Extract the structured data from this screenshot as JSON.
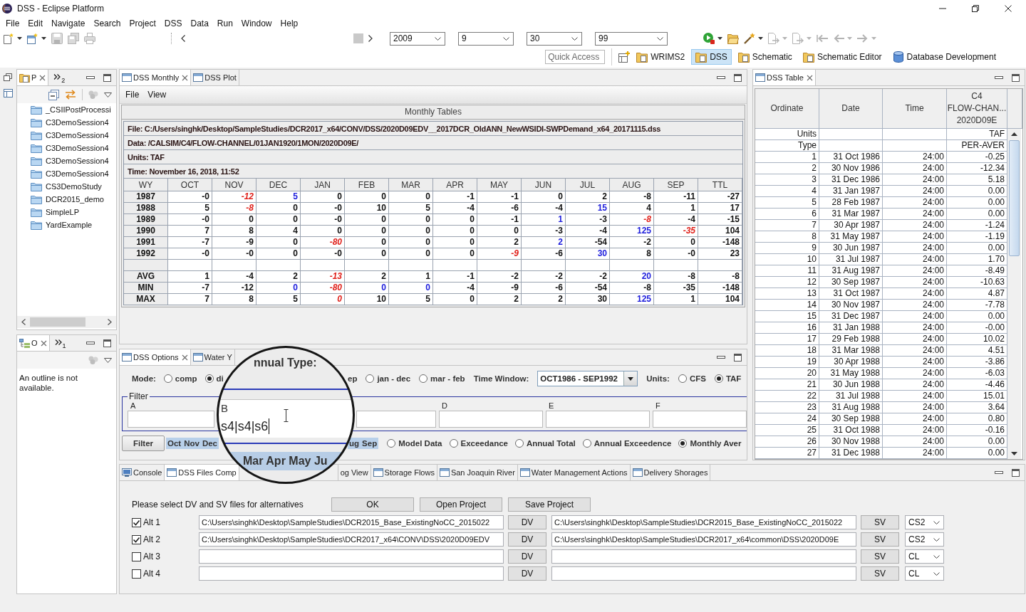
{
  "window": {
    "title": "DSS - Eclipse Platform"
  },
  "menu_bar": [
    "File",
    "Edit",
    "Navigate",
    "Search",
    "Project",
    "DSS",
    "Data",
    "Run",
    "Window",
    "Help"
  ],
  "toolbar": {
    "left": [
      {
        "kind": "new",
        "dropdown": true,
        "disabled": false
      },
      {
        "kind": "new-window",
        "dropdown": true,
        "disabled": false
      },
      {
        "kind": "save",
        "disabled": true
      },
      {
        "kind": "save-all",
        "disabled": true
      },
      {
        "kind": "print",
        "disabled": true
      }
    ],
    "selectors": [
      "2009",
      "9",
      "30",
      "99"
    ],
    "right": [
      {
        "kind": "run",
        "dropdown": true,
        "disabled": false
      },
      {
        "kind": "folder",
        "disabled": false
      },
      {
        "kind": "wand",
        "dropdown": true,
        "disabled": false
      },
      {
        "kind": "document-arrow",
        "dropdown": true,
        "disabled": true
      },
      {
        "kind": "document-arrow",
        "dropdown": true,
        "disabled": true
      },
      {
        "kind": "back",
        "disabled": true
      },
      {
        "kind": "arrow-left",
        "dropdown": true,
        "disabled": true
      },
      {
        "kind": "arrow-right",
        "dropdown": true,
        "disabled": true
      }
    ]
  },
  "quick_access": {
    "placeholder": "Quick Access"
  },
  "perspectives": [
    {
      "label": "WRIMS2",
      "kind": "folder",
      "selected": false
    },
    {
      "label": "DSS",
      "kind": "folder",
      "selected": true
    },
    {
      "label": "Schematic",
      "kind": "folder",
      "selected": false
    },
    {
      "label": "Schematic Editor",
      "kind": "folder",
      "selected": false
    },
    {
      "label": "Database Development",
      "kind": "database",
      "selected": false
    }
  ],
  "explorer": {
    "tab": {
      "label": "P",
      "selected": true
    },
    "overflow": "2",
    "items": [
      {
        "label": "_CSIIPostProcessi",
        "selected": false
      },
      {
        "label": "C3DemoSession4",
        "selected": false
      },
      {
        "label": "C3DemoSession4",
        "selected": false
      },
      {
        "label": "C3DemoSession4",
        "selected": false
      },
      {
        "label": "C3DemoSession4",
        "selected": false
      },
      {
        "label": "C3DemoSession4",
        "selected": false
      },
      {
        "label": "CS3DemoStudy",
        "selected": false
      },
      {
        "label": "DCR2015_demo",
        "selected": false
      },
      {
        "label": "SimpleLP",
        "selected": false
      },
      {
        "label": "YardExample",
        "selected": false
      }
    ]
  },
  "outline": {
    "tab": {
      "label": "O",
      "selected": true
    },
    "overflow": "1",
    "message": "An outline is not available."
  },
  "monthly": {
    "tabs": [
      {
        "label": "DSS Monthly",
        "selected": true
      },
      {
        "label": "DSS Plot",
        "selected": false
      }
    ],
    "menu": [
      "File",
      "View"
    ],
    "title": "Monthly Tables",
    "info": [
      "File: C:/Users/singhk/Desktop/SampleStudies/DCR2017_x64/CONV/DSS/2020D09EDV__2017DCR_OldANN_NewWSIDI-SWPDemand_x64_20171115.dss",
      "Data: /CALSIM/C4/FLOW-CHANNEL/01JAN1920/1MON/2020D09E/",
      "Units: TAF",
      "Time: November 16, 2018, 11:52"
    ],
    "columns": [
      "WY",
      "OCT",
      "NOV",
      "DEC",
      "JAN",
      "FEB",
      "MAR",
      "APR",
      "MAY",
      "JUN",
      "JUL",
      "AUG",
      "SEP",
      "TTL"
    ],
    "rows": [
      {
        "kind": "data",
        "label": "1987",
        "cells": [
          "-0",
          {
            "text": "-12",
            "color": "#e0211b",
            "italic": true
          },
          {
            "text": "5",
            "color": "#1c1cdc"
          },
          "0",
          "0",
          "0",
          "-1",
          "-1",
          "0",
          "2",
          "-8",
          "-11",
          "-27"
        ]
      },
      {
        "kind": "data",
        "label": "1988",
        "cells": [
          "5",
          {
            "text": "-8",
            "color": "#e0211b",
            "italic": true
          },
          "0",
          "-0",
          "10",
          "5",
          "-4",
          "-6",
          "-4",
          {
            "text": "15",
            "color": "#1c1cdc"
          },
          "4",
          "1",
          "17"
        ]
      },
      {
        "kind": "data",
        "label": "1989",
        "cells": [
          "-0",
          "0",
          "0",
          "-0",
          "0",
          "0",
          "0",
          "-1",
          {
            "text": "1",
            "color": "#1c1cdc"
          },
          "-3",
          {
            "text": "-8",
            "color": "#e0211b",
            "italic": true
          },
          "-4",
          "-15"
        ]
      },
      {
        "kind": "data",
        "label": "1990",
        "cells": [
          "7",
          "8",
          "4",
          "0",
          "0",
          "0",
          "0",
          "0",
          "-3",
          "-4",
          {
            "text": "125",
            "color": "#1c1cdc"
          },
          {
            "text": "-35",
            "color": "#e0211b",
            "italic": true
          },
          "104"
        ]
      },
      {
        "kind": "data",
        "label": "1991",
        "cells": [
          "-7",
          "-9",
          "0",
          {
            "text": "-80",
            "color": "#e0211b",
            "italic": true
          },
          "0",
          "0",
          "0",
          "2",
          {
            "text": "2",
            "color": "#1c1cdc"
          },
          "-54",
          "-2",
          "0",
          "-148"
        ]
      },
      {
        "kind": "data",
        "label": "1992",
        "cells": [
          "-0",
          "-0",
          "0",
          "-0",
          "0",
          "0",
          "0",
          {
            "text": "-9",
            "color": "#e0211b",
            "italic": true
          },
          "-6",
          {
            "text": "30",
            "color": "#1c1cdc"
          },
          "8",
          "-0",
          "23"
        ]
      },
      {
        "kind": "spacer"
      },
      {
        "kind": "data",
        "label": "AVG",
        "cells": [
          "1",
          "-4",
          "2",
          {
            "text": "-13",
            "color": "#e0211b",
            "italic": true
          },
          "2",
          "1",
          "-1",
          "-2",
          "-2",
          "-2",
          {
            "text": "20",
            "color": "#1c1cdc"
          },
          "-8",
          "-8"
        ]
      },
      {
        "kind": "data",
        "label": "MIN",
        "cells": [
          "-7",
          "-12",
          {
            "text": "0",
            "color": "#1c1cdc"
          },
          {
            "text": "-80",
            "color": "#e0211b",
            "italic": true
          },
          {
            "text": "0",
            "color": "#1c1cdc"
          },
          {
            "text": "0",
            "color": "#1c1cdc"
          },
          "-4",
          "-9",
          "-6",
          "-54",
          "-8",
          "-35",
          "-148"
        ]
      },
      {
        "kind": "data",
        "label": "MAX",
        "cells": [
          "7",
          "8",
          "5",
          {
            "text": "0",
            "color": "#e0211b",
            "italic": true
          },
          "10",
          "5",
          "0",
          "2",
          "2",
          "30",
          {
            "text": "125",
            "color": "#1c1cdc"
          },
          "1",
          "104"
        ]
      }
    ]
  },
  "options": {
    "tabs": [
      {
        "label": "DSS Options",
        "selected": true
      },
      {
        "label": "Water Y",
        "selected": false
      }
    ],
    "mode": {
      "label": "Mode:",
      "options": [
        {
          "label": "comp",
          "selected": false
        },
        {
          "label": "di",
          "selected": true
        },
        {
          "label": "jan - dec",
          "selected": false
        },
        {
          "label": "mar - feb",
          "selected": false
        }
      ],
      "fragment": "ep"
    },
    "time_window": {
      "label": "Time Window:",
      "value": "OCT1986 - SEP1992"
    },
    "units": {
      "label": "Units:",
      "options": [
        {
          "label": "CFS",
          "selected": false
        },
        {
          "label": "TAF",
          "selected": true
        }
      ]
    },
    "filter": {
      "title": "Filter",
      "fields": [
        {
          "kind": "labeled",
          "label": "A"
        },
        {
          "kind": "unlabeled"
        },
        {
          "kind": "labeled",
          "label": "D"
        },
        {
          "kind": "labeled",
          "label": "E"
        },
        {
          "kind": "labeled",
          "label": "F"
        }
      ]
    },
    "filter_button": "Filter",
    "months_left": [
      {
        "label": "Oct",
        "selected": true
      },
      {
        "label": "Nov",
        "selected": true
      },
      {
        "label": "Dec",
        "selected": true
      }
    ],
    "months_right": [
      {
        "label": "ug",
        "selected": true
      },
      {
        "label": "Sep",
        "selected": true
      }
    ],
    "views": [
      {
        "label": "Model Data",
        "selected": false
      },
      {
        "label": "Exceedance",
        "selected": false
      },
      {
        "label": "Annual Total",
        "selected": false
      },
      {
        "label": "Annual Exceedence",
        "selected": false
      },
      {
        "label": "Monthly Aver",
        "selected": true
      }
    ]
  },
  "magnifier": {
    "heading": "nnual Type:",
    "field_label": "B",
    "field_value": "s4|s4|s6",
    "months": "Mar Apr May Ju"
  },
  "table_view": {
    "tab": {
      "label": "DSS Table",
      "selected": true
    },
    "columns": [
      "Ordinate",
      "Date",
      "Time"
    ],
    "series_header": [
      "C4",
      "FLOW-CHAN...",
      "2020D09E"
    ],
    "meta_rows": [
      {
        "label": "Units",
        "value": "TAF"
      },
      {
        "label": "Type",
        "value": "PER-AVER"
      }
    ],
    "rows": [
      {
        "ordinate": "1",
        "date": "31 Oct 1986",
        "time": "24:00",
        "value": "-0.25"
      },
      {
        "ordinate": "2",
        "date": "30 Nov 1986",
        "time": "24:00",
        "value": "-12.34"
      },
      {
        "ordinate": "3",
        "date": "31 Dec 1986",
        "time": "24:00",
        "value": "5.18"
      },
      {
        "ordinate": "4",
        "date": "31 Jan 1987",
        "time": "24:00",
        "value": "0.00"
      },
      {
        "ordinate": "5",
        "date": "28 Feb 1987",
        "time": "24:00",
        "value": "0.00"
      },
      {
        "ordinate": "6",
        "date": "31 Mar 1987",
        "time": "24:00",
        "value": "0.00"
      },
      {
        "ordinate": "7",
        "date": "30 Apr 1987",
        "time": "24:00",
        "value": "-1.24"
      },
      {
        "ordinate": "8",
        "date": "31 May 1987",
        "time": "24:00",
        "value": "-1.19"
      },
      {
        "ordinate": "9",
        "date": "30 Jun 1987",
        "time": "24:00",
        "value": "0.00"
      },
      {
        "ordinate": "10",
        "date": "31 Jul 1987",
        "time": "24:00",
        "value": "1.70"
      },
      {
        "ordinate": "11",
        "date": "31 Aug 1987",
        "time": "24:00",
        "value": "-8.49"
      },
      {
        "ordinate": "12",
        "date": "30 Sep 1987",
        "time": "24:00",
        "value": "-10.63"
      },
      {
        "ordinate": "13",
        "date": "31 Oct 1987",
        "time": "24:00",
        "value": "4.87"
      },
      {
        "ordinate": "14",
        "date": "30 Nov 1987",
        "time": "24:00",
        "value": "-7.78"
      },
      {
        "ordinate": "15",
        "date": "31 Dec 1987",
        "time": "24:00",
        "value": "0.00"
      },
      {
        "ordinate": "16",
        "date": "31 Jan 1988",
        "time": "24:00",
        "value": "-0.00"
      },
      {
        "ordinate": "17",
        "date": "29 Feb 1988",
        "time": "24:00",
        "value": "10.02"
      },
      {
        "ordinate": "18",
        "date": "31 Mar 1988",
        "time": "24:00",
        "value": "4.51"
      },
      {
        "ordinate": "19",
        "date": "30 Apr 1988",
        "time": "24:00",
        "value": "-3.86"
      },
      {
        "ordinate": "20",
        "date": "31 May 1988",
        "time": "24:00",
        "value": "-6.03"
      },
      {
        "ordinate": "21",
        "date": "30 Jun 1988",
        "time": "24:00",
        "value": "-4.46"
      },
      {
        "ordinate": "22",
        "date": "31 Jul 1988",
        "time": "24:00",
        "value": "15.01"
      },
      {
        "ordinate": "23",
        "date": "31 Aug 1988",
        "time": "24:00",
        "value": "3.64"
      },
      {
        "ordinate": "24",
        "date": "30 Sep 1988",
        "time": "24:00",
        "value": "0.80"
      },
      {
        "ordinate": "25",
        "date": "31 Oct 1988",
        "time": "24:00",
        "value": "-0.16"
      },
      {
        "ordinate": "26",
        "date": "30 Nov 1988",
        "time": "24:00",
        "value": "0.00"
      },
      {
        "ordinate": "27",
        "date": "31 Dec 1988",
        "time": "24:00",
        "value": "0.00"
      }
    ]
  },
  "bottom": {
    "tabs": [
      {
        "label": "Console",
        "kind": "console",
        "selected": false
      },
      {
        "label": "DSS Files Comp",
        "kind": "view",
        "selected": true
      },
      {
        "label": "og View",
        "kind": "fragment",
        "selected": false
      },
      {
        "label": "Storage Flows",
        "kind": "view",
        "selected": false
      },
      {
        "label": "San Joaquin River",
        "kind": "view",
        "selected": false
      },
      {
        "label": "Water Management Actions",
        "kind": "view",
        "selected": false
      },
      {
        "label": "Delivery Shorages",
        "kind": "view",
        "selected": false
      }
    ],
    "prompt": "Please select DV and SV files for alternatives",
    "buttons": [
      "OK",
      "Open Project",
      "Save Project"
    ],
    "alternatives": [
      {
        "label": "Alt 1",
        "checked": true,
        "dv_path": "C:\\Users\\singhk\\Desktop\\SampleStudies\\DCR2015_Base_ExistingNoCC_2015022",
        "dv_button": "DV",
        "sv_path": "C:\\Users\\singhk\\Desktop\\SampleStudies\\DCR2015_Base_ExistingNoCC_2015022",
        "sv_button": "SV",
        "study": "CS2"
      },
      {
        "label": "Alt 2",
        "checked": true,
        "dv_path": "C:\\Users\\singhk\\Desktop\\SampleStudies\\DCR2017_x64\\CONV\\DSS\\2020D09EDV",
        "dv_button": "DV",
        "sv_path": "C:\\Users\\singhk\\Desktop\\SampleStudies\\DCR2017_x64\\common\\DSS\\2020D09E",
        "sv_button": "SV",
        "study": "CS2"
      },
      {
        "label": "Alt 3",
        "checked": false,
        "dv_button": "DV",
        "sv_button": "SV",
        "study": "CL"
      },
      {
        "label": "Alt 4",
        "checked": false,
        "dv_button": "DV",
        "sv_button": "SV",
        "study": "CL"
      }
    ]
  }
}
